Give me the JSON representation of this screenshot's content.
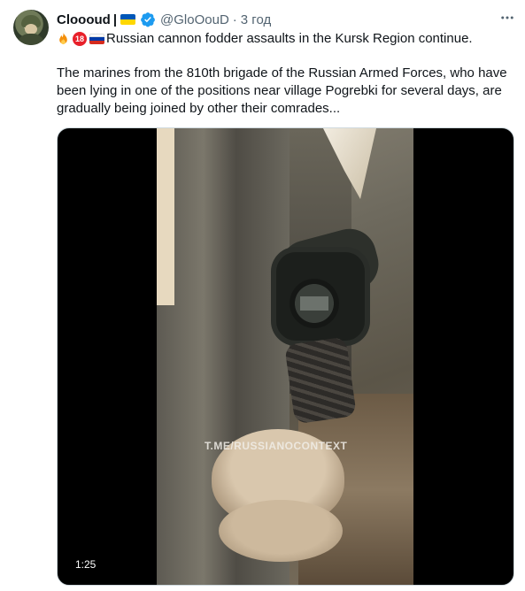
{
  "tweet": {
    "author_name": "Cloooud",
    "name_separator": "|",
    "handle": "@GloOouD",
    "separator_dot": "·",
    "time": "3 год",
    "emoji_18": "18",
    "text_line1": "Russian cannon fodder assaults in the Kursk Region continue.",
    "text_paragraph": "The marines from the 810th brigade of the Russian Armed Forces, who have been lying in one of the positions near village Pogrebki for several days, are gradually being joined by other their comrades...",
    "video_watermark": "T.ME/RUSSIANOCONTEXT",
    "video_duration": "1:25",
    "colors": {
      "verified": "#1d9bf0",
      "ua_blue": "#0057b7",
      "ua_yellow": "#ffd700",
      "secondary_text": "#536471"
    },
    "icons": [
      "verified-badge-icon",
      "more-options-icon",
      "fire-emoji-icon",
      "under-18-emoji-icon",
      "russia-flag-emoji-icon",
      "ukraine-flag-emoji-icon"
    ]
  }
}
